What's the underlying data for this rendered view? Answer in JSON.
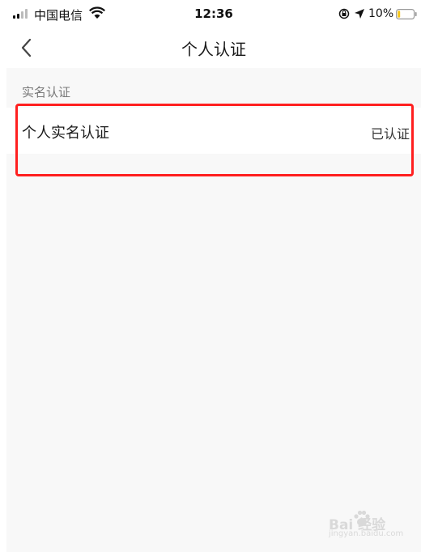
{
  "status_bar": {
    "carrier": "中国电信",
    "time": "12:36",
    "battery_percent": "10%",
    "battery_level": 0.1,
    "signal_bars_filled": 2,
    "signal_bars_total": 4
  },
  "nav": {
    "title": "个人认证",
    "back_icon": "chevron-left-icon"
  },
  "section": {
    "header": "实名认证",
    "items": [
      {
        "label": "个人实名认证",
        "status": "已认证"
      }
    ]
  },
  "watermark": {
    "text": "Bai 经验",
    "sub": "jingyan.baidu.com"
  },
  "colors": {
    "highlight": "#ff1f1f",
    "background": "#f8f8f8",
    "surface": "#ffffff",
    "battery_fill": "#f5c518"
  }
}
